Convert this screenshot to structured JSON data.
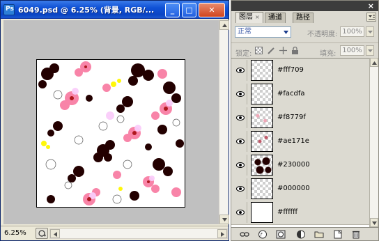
{
  "document": {
    "title": "6049.psd @ 6.25% (背景, RGB/...",
    "zoom": "6.25%",
    "app_icon_text": "Ps",
    "window_buttons": {
      "minimize": "_",
      "maximize": "□",
      "close": "✕"
    }
  },
  "layers_panel": {
    "tabs": [
      {
        "label": "图层",
        "active": true
      },
      {
        "label": "通道",
        "active": false
      },
      {
        "label": "路径",
        "active": false
      }
    ],
    "blend_mode": "正常",
    "opacity_label": "不透明度:",
    "opacity_value": "100%",
    "lock_label": "锁定:",
    "fill_label": "填充:",
    "fill_value": "100%",
    "layers": [
      {
        "name": "#fff709",
        "visible": true,
        "thumbnail": "transparent"
      },
      {
        "name": "#facdfa",
        "visible": true,
        "thumbnail": "transparent"
      },
      {
        "name": "#f8779f",
        "visible": true,
        "thumbnail": "pinkish"
      },
      {
        "name": "#ae171e",
        "visible": true,
        "thumbnail": "reddish"
      },
      {
        "name": "#230000",
        "visible": true,
        "thumbnail": "dark"
      },
      {
        "name": "#000000",
        "visible": true,
        "thumbnail": "transparent"
      },
      {
        "name": "#ffffff",
        "visible": true,
        "thumbnail": "white"
      }
    ],
    "footer_icons": [
      "link-icon",
      "fx-icon",
      "mask-icon",
      "adjustment-icon",
      "group-folder-icon",
      "new-layer-icon",
      "trash-icon"
    ]
  },
  "colors": {
    "titlebar": "#1052d6",
    "canvas_bg": "#c0c0c0",
    "panel_bg": "#dcdad1",
    "flower_dark": "#230000",
    "flower_pink": "#f8779f",
    "flower_light_pink": "#facdfa",
    "flower_red": "#ae171e",
    "flower_yellow": "#fff709"
  }
}
